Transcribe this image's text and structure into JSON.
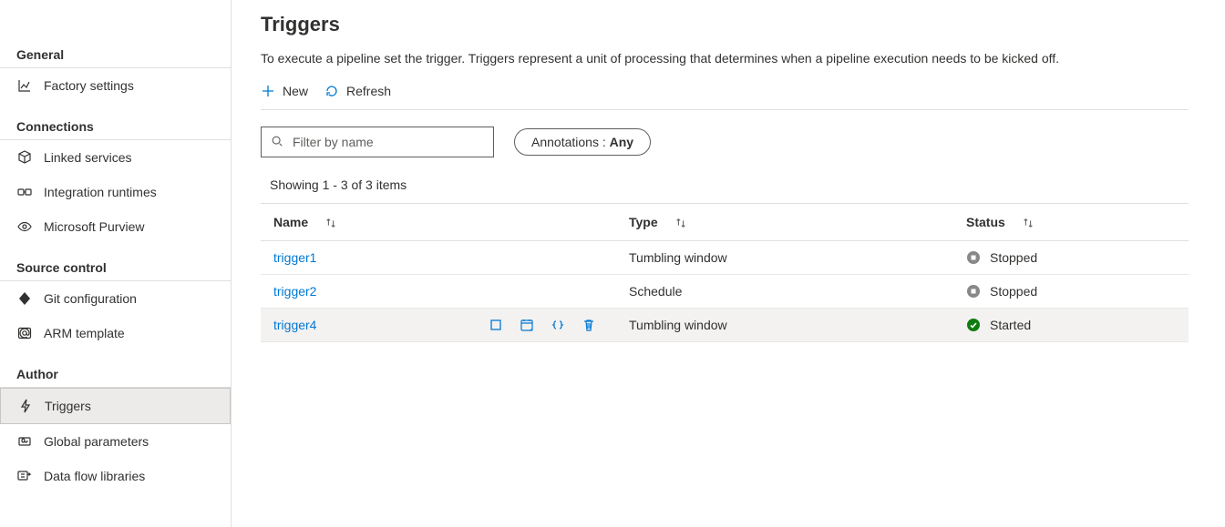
{
  "sidebar": {
    "sections": [
      {
        "title": "General",
        "items": [
          {
            "label": "Factory settings",
            "icon": "chart-icon"
          }
        ]
      },
      {
        "title": "Connections",
        "items": [
          {
            "label": "Linked services",
            "icon": "cube-icon"
          },
          {
            "label": "Integration runtimes",
            "icon": "runtimes-icon"
          },
          {
            "label": "Microsoft Purview",
            "icon": "eye-icon"
          }
        ]
      },
      {
        "title": "Source control",
        "items": [
          {
            "label": "Git configuration",
            "icon": "diamond-icon"
          },
          {
            "label": "ARM template",
            "icon": "at-icon"
          }
        ]
      },
      {
        "title": "Author",
        "items": [
          {
            "label": "Triggers",
            "icon": "bolt-icon",
            "active": true
          },
          {
            "label": "Global parameters",
            "icon": "globals-icon"
          },
          {
            "label": "Data flow libraries",
            "icon": "dataflow-icon"
          }
        ]
      }
    ]
  },
  "page": {
    "title": "Triggers",
    "description": "To execute a pipeline set the trigger. Triggers represent a unit of processing that determines when a pipeline execution needs to be kicked off."
  },
  "toolbar": {
    "new_label": "New",
    "refresh_label": "Refresh"
  },
  "filter": {
    "placeholder": "Filter by name",
    "annotations_label": "Annotations : ",
    "annotations_value": "Any"
  },
  "listing": {
    "count_text": "Showing 1 - 3 of 3 items"
  },
  "columns": {
    "name": "Name",
    "type": "Type",
    "status": "Status"
  },
  "rows": [
    {
      "name": "trigger1",
      "type": "Tumbling window",
      "status": "Stopped",
      "hovered": false
    },
    {
      "name": "trigger2",
      "type": "Schedule",
      "status": "Stopped",
      "hovered": false
    },
    {
      "name": "trigger4",
      "type": "Tumbling window",
      "status": "Started",
      "hovered": true
    }
  ],
  "colors": {
    "link": "#0078d4",
    "stopped": "#8a8886",
    "started": "#107c10"
  }
}
